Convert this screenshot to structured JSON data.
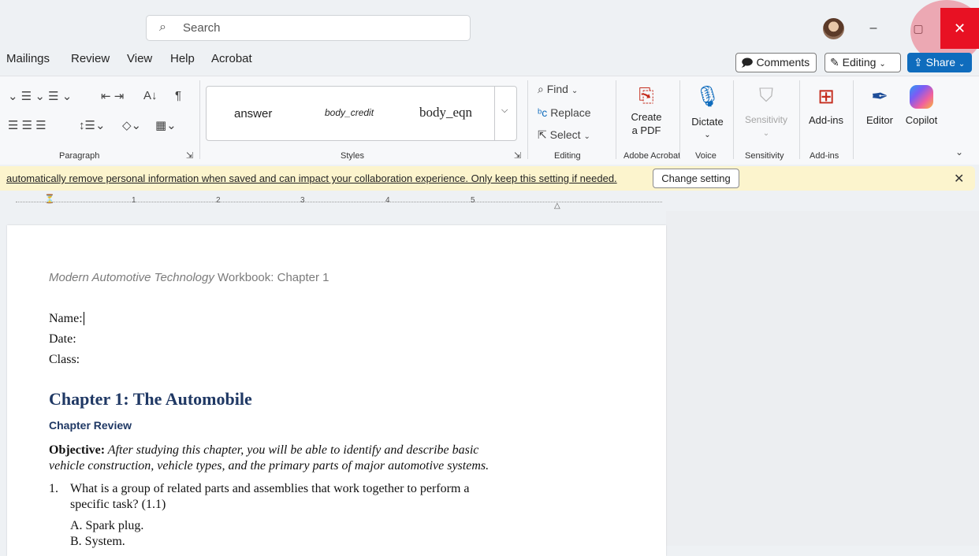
{
  "titlebar": {
    "search_placeholder": "Search",
    "window_controls": {
      "minimize": "–",
      "restore": "▢",
      "close": "✕"
    }
  },
  "menus": [
    "Mailings",
    "Review",
    "View",
    "Help",
    "Acrobat"
  ],
  "toolbar_right": {
    "comments_label": "Comments",
    "editing_label": "Editing",
    "share_label": "Share"
  },
  "ribbon": {
    "groups": {
      "paragraph": "Paragraph",
      "styles": "Styles",
      "editing": "Editing",
      "adobe": "Adobe Acrobat",
      "voice": "Voice",
      "sensitivity": "Sensitivity",
      "addins": "Add-ins"
    },
    "styles": [
      "answer",
      "body_credit",
      "body_eqn"
    ],
    "editing_buttons": {
      "find": "Find",
      "replace": "Replace",
      "select": "Select"
    },
    "create_pdf": [
      "Create",
      "a PDF"
    ],
    "dictate": "Dictate",
    "sensitivity": "Sensitivity",
    "addins": "Add-ins",
    "editor": "Editor",
    "copilot": "Copilot"
  },
  "notification": {
    "text": "automatically remove personal information when saved and can impact your collaboration experience. Only keep this setting if needed.",
    "button": "Change setting"
  },
  "ruler": {
    "numbers": [
      "1",
      "2",
      "3",
      "4",
      "5"
    ]
  },
  "document": {
    "header_italic": "Modern Automotive Technology",
    "header_rest": " Workbook: Chapter 1",
    "fields": [
      "Name:",
      "Date:",
      "Class:"
    ],
    "chapter_title": "Chapter 1: The Automobile",
    "section_title": "Chapter Review",
    "objective_label": "Objective:",
    "objective_line1": " After studying this chapter, you will be able to identify and describe basic",
    "objective_line2": "vehicle construction, vehicle types, and the primary parts of major automotive systems.",
    "q1_number": "1.",
    "q1_line1": "What is a group of related parts and assemblies that work together to perform a",
    "q1_line2": "specific task? (1.1)",
    "q1_options": [
      "A. Spark plug.",
      "B. System."
    ]
  },
  "colors": {
    "accent": "#0f6cbd",
    "close_red": "#e81123",
    "notification_bg": "#fcf4cd",
    "heading_blue": "#1f3864"
  }
}
